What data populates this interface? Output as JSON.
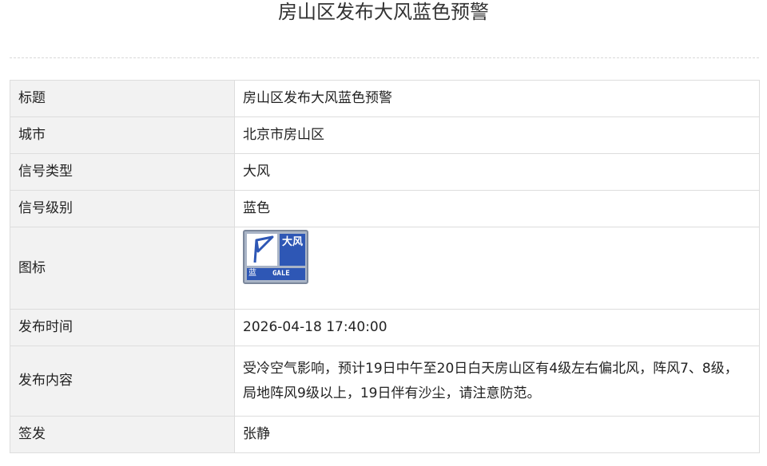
{
  "page": {
    "title": "房山区发布大风蓝色预警"
  },
  "table": {
    "rows": [
      {
        "key": "标题",
        "value": "房山区发布大风蓝色预警"
      },
      {
        "key": "城市",
        "value": "北京市房山区"
      },
      {
        "key": "信号类型",
        "value": "大风"
      },
      {
        "key": "信号级别",
        "value": "蓝色"
      },
      {
        "key": "图标",
        "value": ""
      },
      {
        "key": "发布时间",
        "value": "2026-04-18 17:40:00"
      },
      {
        "key": "发布内容",
        "value": "受冷空气影响，预计19日中午至20日白天房山区有4级左右偏北风，阵风7、8级，局地阵风9级以上，19日伴有沙尘，请注意防范。"
      },
      {
        "key": "签发",
        "value": "张静"
      }
    ]
  },
  "icon": {
    "name": "gale-blue-warning-icon",
    "chars": "大风",
    "color_char": "蓝",
    "english": "GALE",
    "accent_color": "#2e57b5",
    "frame_color": "#a9b4c6"
  }
}
